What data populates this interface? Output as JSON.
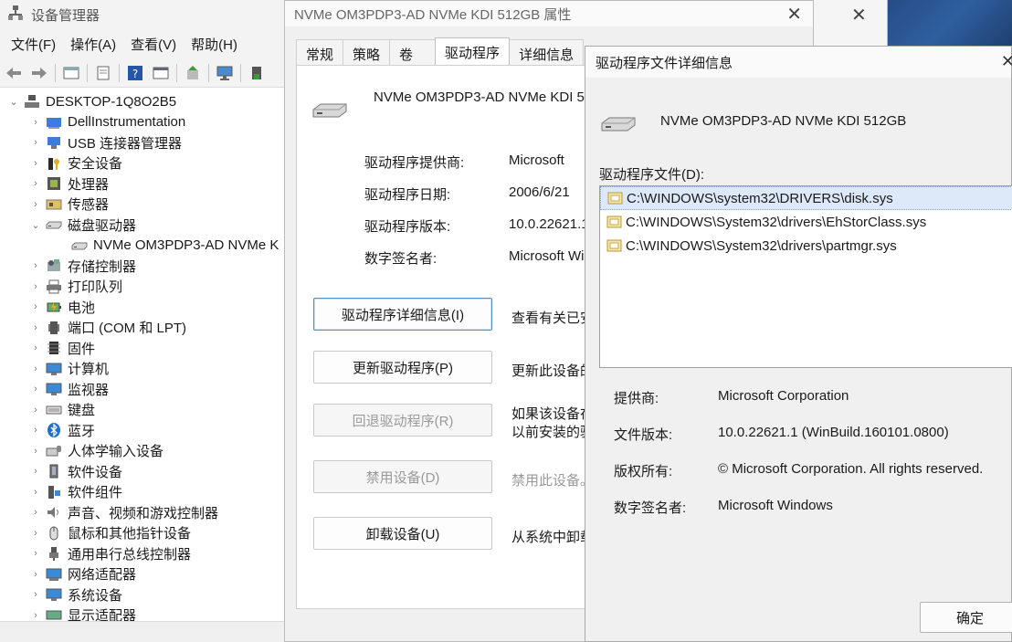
{
  "devmgr": {
    "title": "设备管理器",
    "menu": [
      "文件(F)",
      "操作(A)",
      "查看(V)",
      "帮助(H)"
    ],
    "root": "DESKTOP-1Q8O2B5",
    "tree": [
      {
        "label": "DellInstrumentation",
        "icon": "dell-icon",
        "expanded": false
      },
      {
        "label": "USB 连接器管理器",
        "icon": "usb-icon",
        "expanded": false
      },
      {
        "label": "安全设备",
        "icon": "security-icon",
        "expanded": false
      },
      {
        "label": "处理器",
        "icon": "cpu-icon",
        "expanded": false
      },
      {
        "label": "传感器",
        "icon": "sensor-icon",
        "expanded": false
      },
      {
        "label": "磁盘驱动器",
        "icon": "disk-icon",
        "expanded": true
      },
      {
        "label": "NVMe OM3PDP3-AD NVMe K",
        "icon": "disk-icon",
        "child": true
      },
      {
        "label": "存储控制器",
        "icon": "storage-icon",
        "expanded": false
      },
      {
        "label": "打印队列",
        "icon": "printer-icon",
        "expanded": false
      },
      {
        "label": "电池",
        "icon": "battery-icon",
        "expanded": false
      },
      {
        "label": "端口 (COM 和 LPT)",
        "icon": "port-icon",
        "expanded": false
      },
      {
        "label": "固件",
        "icon": "firmware-icon",
        "expanded": false
      },
      {
        "label": "计算机",
        "icon": "computer-icon",
        "expanded": false
      },
      {
        "label": "监视器",
        "icon": "monitor-icon",
        "expanded": false
      },
      {
        "label": "键盘",
        "icon": "keyboard-icon",
        "expanded": false
      },
      {
        "label": "蓝牙",
        "icon": "bluetooth-icon",
        "expanded": false
      },
      {
        "label": "人体学输入设备",
        "icon": "hid-icon",
        "expanded": false
      },
      {
        "label": "软件设备",
        "icon": "software-device-icon",
        "expanded": false
      },
      {
        "label": "软件组件",
        "icon": "software-component-icon",
        "expanded": false
      },
      {
        "label": "声音、视频和游戏控制器",
        "icon": "sound-icon",
        "expanded": false
      },
      {
        "label": "鼠标和其他指针设备",
        "icon": "mouse-icon",
        "expanded": false
      },
      {
        "label": "通用串行总线控制器",
        "icon": "usb-controller-icon",
        "expanded": false
      },
      {
        "label": "网络适配器",
        "icon": "network-icon",
        "expanded": false
      },
      {
        "label": "系统设备",
        "icon": "system-icon",
        "expanded": false
      },
      {
        "label": "显示适配器",
        "icon": "display-adapter-icon",
        "expanded": false
      }
    ]
  },
  "props": {
    "title": "NVMe OM3PDP3-AD NVMe KDI 512GB 属性",
    "tabs": [
      "常规",
      "策略",
      "卷",
      "驱动程序",
      "详细信息"
    ],
    "active_tab": "驱动程序",
    "device_name": "NVMe OM3PDP3-AD NVMe KDI 5",
    "fields": [
      {
        "label": "驱动程序提供商:",
        "value": "Microsoft"
      },
      {
        "label": "驱动程序日期:",
        "value": "2006/6/21"
      },
      {
        "label": "驱动程序版本:",
        "value": "10.0.22621.1"
      },
      {
        "label": "数字签名者:",
        "value": "Microsoft Wi"
      }
    ],
    "buttons": [
      {
        "label": "驱动程序详细信息(I)",
        "desc": "查看有关已安"
      },
      {
        "label": "更新驱动程序(P)",
        "desc": "更新此设备的"
      },
      {
        "label": "回退驱动程序(R)",
        "desc": "如果该设备在",
        "desc2": "以前安装的驱"
      },
      {
        "label": "禁用设备(D)",
        "desc": "禁用此设备。"
      },
      {
        "label": "卸载设备(U)",
        "desc": "从系统中卸载"
      }
    ]
  },
  "details": {
    "title": "驱动程序文件详细信息",
    "device_name": "NVMe OM3PDP3-AD NVMe KDI 512GB",
    "files_label": "驱动程序文件(D):",
    "files": [
      "C:\\WINDOWS\\system32\\DRIVERS\\disk.sys",
      "C:\\WINDOWS\\System32\\drivers\\EhStorClass.sys",
      "C:\\WINDOWS\\System32\\drivers\\partmgr.sys"
    ],
    "info": [
      {
        "label": "提供商:",
        "value": "Microsoft Corporation"
      },
      {
        "label": "文件版本:",
        "value": "10.0.22621.1 (WinBuild.160101.0800)"
      },
      {
        "label": "版权所有:",
        "value": "© Microsoft Corporation. All rights reserved."
      },
      {
        "label": "数字签名者:",
        "value": "Microsoft Windows"
      }
    ],
    "ok_label": "确定"
  }
}
